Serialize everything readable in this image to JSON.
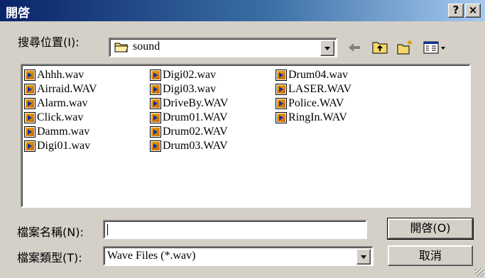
{
  "window": {
    "title": "開啓",
    "help_label": "?",
    "close_label": "×"
  },
  "lookin": {
    "label": "搜尋位置(I):",
    "value": "sound"
  },
  "toolbar": {
    "back_icon": "back-arrow-icon",
    "up_icon": "up-folder-icon",
    "new_folder_icon": "new-folder-icon",
    "view_menu_icon": "view-menu-icon"
  },
  "files": {
    "col1": [
      "Ahhh.wav",
      "Airraid.WAV",
      "Alarm.wav",
      "Click.wav",
      "Damm.wav",
      "Digi01.wav"
    ],
    "col2": [
      "Digi02.wav",
      "Digi03.wav",
      "DriveBy.WAV",
      "Drum01.WAV",
      "Drum02.WAV",
      "Drum03.WAV"
    ],
    "col3": [
      "Drum04.wav",
      "LASER.WAV",
      "Police.WAV",
      "RingIn.WAV"
    ]
  },
  "filename": {
    "label": "檔案名稱(N):",
    "value": ""
  },
  "filetype": {
    "label": "檔案類型(T):",
    "value": "Wave Files (*.wav)"
  },
  "buttons": {
    "open": "開啓(O)",
    "cancel": "取消"
  }
}
